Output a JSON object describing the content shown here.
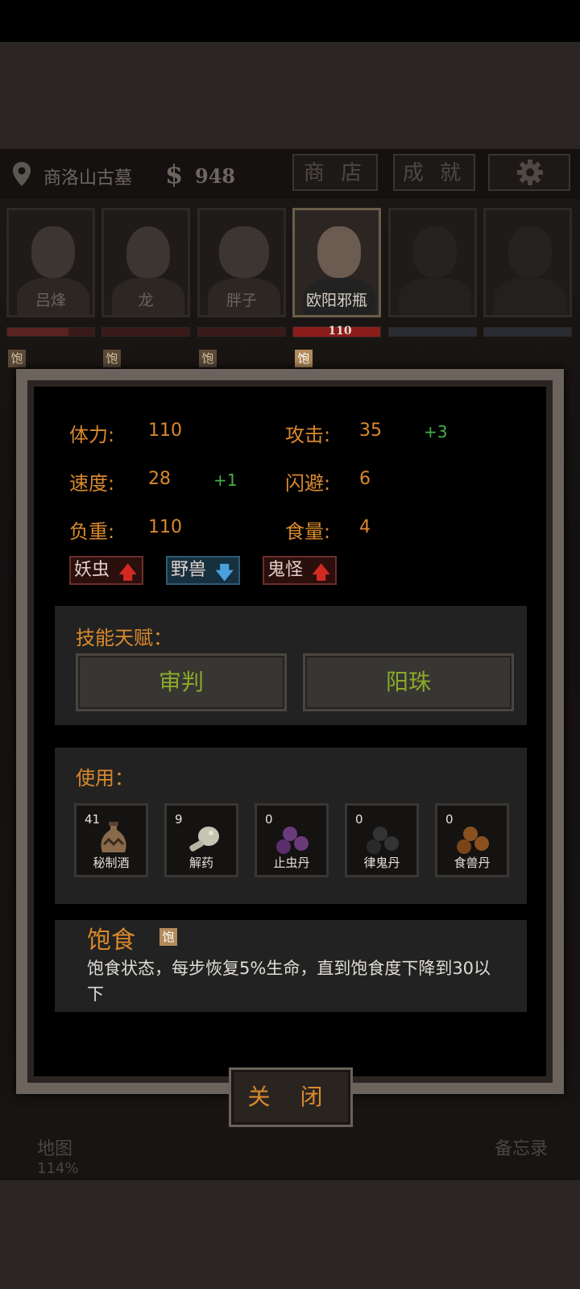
{
  "hud": {
    "location": "商洛山古墓",
    "currency_symbol": "$",
    "gold": "948",
    "shop_label": "商 店",
    "achievement_label": "成 就"
  },
  "party": [
    {
      "name": "吕烽",
      "food_badge": "饱"
    },
    {
      "name": "龙",
      "food_badge": "饱"
    },
    {
      "name": "胖子",
      "food_badge": "饱"
    },
    {
      "name": "欧阳邪瓶",
      "food_badge": "饱",
      "hp": "110"
    },
    {
      "name": ""
    },
    {
      "name": ""
    }
  ],
  "stats": {
    "stamina_label": "体力:",
    "stamina": "110",
    "attack_label": "攻击:",
    "attack": "35",
    "attack_bonus": "+3",
    "speed_label": "速度:",
    "speed": "28",
    "speed_bonus": "+1",
    "dodge_label": "闪避:",
    "dodge": "6",
    "load_label": "负重:",
    "load": "110",
    "food_label": "食量:",
    "food": "4"
  },
  "traits": [
    {
      "label": "妖虫",
      "direction": "up"
    },
    {
      "label": "野兽",
      "direction": "down"
    },
    {
      "label": "鬼怪",
      "direction": "up"
    }
  ],
  "skills": {
    "title": "技能天赋：",
    "items": [
      "审判",
      "阳珠"
    ]
  },
  "use": {
    "title": "使用：",
    "items": [
      {
        "count": "41",
        "name": "秘制酒"
      },
      {
        "count": "9",
        "name": "解药"
      },
      {
        "count": "0",
        "name": "止虫丹"
      },
      {
        "count": "0",
        "name": "律鬼丹"
      },
      {
        "count": "0",
        "name": "食兽丹"
      }
    ]
  },
  "status": {
    "title": "饱食",
    "badge": "饱",
    "description": "饱食状态，每步恢复5%生命，直到饱食度下降到30以下"
  },
  "close_label": "关 闭",
  "background": {
    "map_label": "地图",
    "map_percent": "114%",
    "memo_label": "备忘录"
  },
  "colors": {
    "accent_orange": "#d9892d",
    "bonus_green": "#46b04a",
    "skill_green": "#8aaa2a"
  }
}
